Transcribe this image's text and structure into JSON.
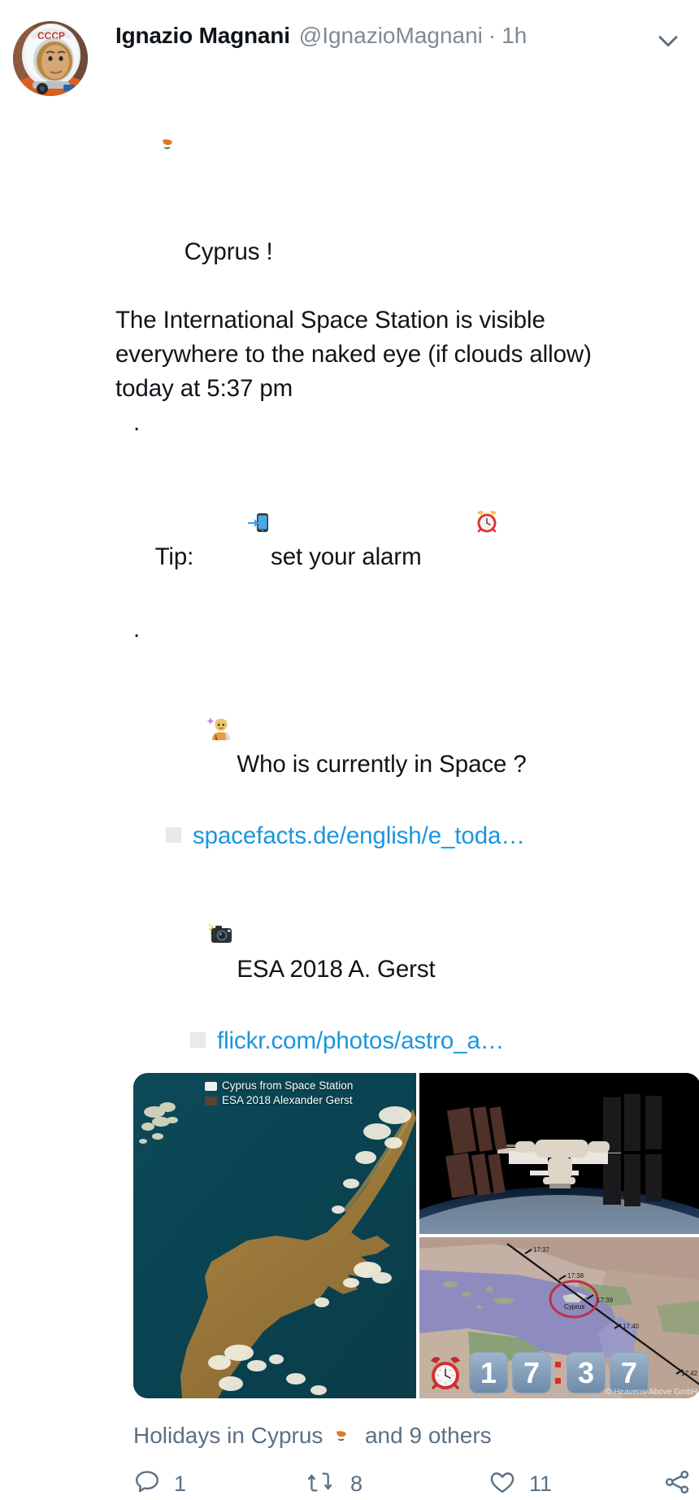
{
  "author": {
    "display_name": "Ignazio Magnani",
    "handle": "@IgnazioMagnani",
    "separator": "·",
    "timestamp": "1h",
    "avatar_alt": "cosmonaut-portrait"
  },
  "menu": {
    "caret_icon": "chevron-down-icon"
  },
  "tweet": {
    "line1_flag_emoji": "🇨🇾",
    "line1_text": "Cyprus !",
    "line2": "The International Space Station is visible",
    "line3": "everywhere to the naked eye (if clouds allow)",
    "line4": "today at 5:37 pm",
    "spacer_dot": ".",
    "tip_label": "Tip:",
    "tip_phone_emoji": "📲",
    "tip_text": "set your alarm",
    "tip_alarm_emoji": "⏰",
    "spacer_dot2": ".",
    "astronaut_emoji": "🧑‍🚀",
    "question_text": "Who is currently in Space ?",
    "link1": "spacefacts.de/english/e_toda…",
    "camera_emoji": "📸",
    "credit_text": "ESA 2018 A. Gerst",
    "link2": "flickr.com/photos/astro_a…"
  },
  "media": {
    "photo_caption_line1": "Cyprus from Space Station",
    "photo_caption_line2": "ESA 2018 Alexander Gerst",
    "caption_icon1": "flag-icon",
    "caption_icon2": "camera-icon",
    "left_alt": "cyprus-satellite-photo",
    "iss_alt": "international-space-station-photo",
    "map_alt": "iss-ground-track-map",
    "map_labels": [
      "17:37",
      "17:38",
      "17:39",
      "17:40",
      "17:42"
    ],
    "map_place_label": "Cyprus",
    "clock_digits": [
      "1",
      "7",
      "3",
      "7"
    ],
    "clock_icon": "alarm-clock-icon",
    "watermark": "© Heavens-Above GmbH"
  },
  "context": {
    "text_before": "Holidays in Cyprus",
    "flag_emoji": "🇨🇾",
    "text_after": "and 9 others"
  },
  "actions": {
    "reply": {
      "icon": "reply-icon",
      "count": "1"
    },
    "retweet": {
      "icon": "retweet-icon",
      "count": "8"
    },
    "like": {
      "icon": "heart-icon",
      "count": "11"
    },
    "share": {
      "icon": "share-icon"
    }
  },
  "colors": {
    "text": "#0f1419",
    "muted": "#5b7083",
    "handle": "#7d8b97",
    "link": "#1b95e0",
    "background": "#ffffff"
  }
}
